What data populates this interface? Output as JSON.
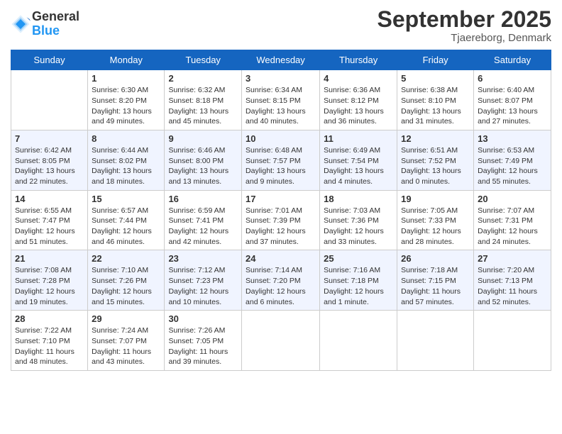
{
  "logo": {
    "general": "General",
    "blue": "Blue"
  },
  "header": {
    "title": "September 2025",
    "subtitle": "Tjaereborg, Denmark"
  },
  "weekdays": [
    "Sunday",
    "Monday",
    "Tuesday",
    "Wednesday",
    "Thursday",
    "Friday",
    "Saturday"
  ],
  "weeks": [
    [
      {
        "day": "",
        "info": ""
      },
      {
        "day": "1",
        "info": "Sunrise: 6:30 AM\nSunset: 8:20 PM\nDaylight: 13 hours\nand 49 minutes."
      },
      {
        "day": "2",
        "info": "Sunrise: 6:32 AM\nSunset: 8:18 PM\nDaylight: 13 hours\nand 45 minutes."
      },
      {
        "day": "3",
        "info": "Sunrise: 6:34 AM\nSunset: 8:15 PM\nDaylight: 13 hours\nand 40 minutes."
      },
      {
        "day": "4",
        "info": "Sunrise: 6:36 AM\nSunset: 8:12 PM\nDaylight: 13 hours\nand 36 minutes."
      },
      {
        "day": "5",
        "info": "Sunrise: 6:38 AM\nSunset: 8:10 PM\nDaylight: 13 hours\nand 31 minutes."
      },
      {
        "day": "6",
        "info": "Sunrise: 6:40 AM\nSunset: 8:07 PM\nDaylight: 13 hours\nand 27 minutes."
      }
    ],
    [
      {
        "day": "7",
        "info": "Sunrise: 6:42 AM\nSunset: 8:05 PM\nDaylight: 13 hours\nand 22 minutes."
      },
      {
        "day": "8",
        "info": "Sunrise: 6:44 AM\nSunset: 8:02 PM\nDaylight: 13 hours\nand 18 minutes."
      },
      {
        "day": "9",
        "info": "Sunrise: 6:46 AM\nSunset: 8:00 PM\nDaylight: 13 hours\nand 13 minutes."
      },
      {
        "day": "10",
        "info": "Sunrise: 6:48 AM\nSunset: 7:57 PM\nDaylight: 13 hours\nand 9 minutes."
      },
      {
        "day": "11",
        "info": "Sunrise: 6:49 AM\nSunset: 7:54 PM\nDaylight: 13 hours\nand 4 minutes."
      },
      {
        "day": "12",
        "info": "Sunrise: 6:51 AM\nSunset: 7:52 PM\nDaylight: 13 hours\nand 0 minutes."
      },
      {
        "day": "13",
        "info": "Sunrise: 6:53 AM\nSunset: 7:49 PM\nDaylight: 12 hours\nand 55 minutes."
      }
    ],
    [
      {
        "day": "14",
        "info": "Sunrise: 6:55 AM\nSunset: 7:47 PM\nDaylight: 12 hours\nand 51 minutes."
      },
      {
        "day": "15",
        "info": "Sunrise: 6:57 AM\nSunset: 7:44 PM\nDaylight: 12 hours\nand 46 minutes."
      },
      {
        "day": "16",
        "info": "Sunrise: 6:59 AM\nSunset: 7:41 PM\nDaylight: 12 hours\nand 42 minutes."
      },
      {
        "day": "17",
        "info": "Sunrise: 7:01 AM\nSunset: 7:39 PM\nDaylight: 12 hours\nand 37 minutes."
      },
      {
        "day": "18",
        "info": "Sunrise: 7:03 AM\nSunset: 7:36 PM\nDaylight: 12 hours\nand 33 minutes."
      },
      {
        "day": "19",
        "info": "Sunrise: 7:05 AM\nSunset: 7:33 PM\nDaylight: 12 hours\nand 28 minutes."
      },
      {
        "day": "20",
        "info": "Sunrise: 7:07 AM\nSunset: 7:31 PM\nDaylight: 12 hours\nand 24 minutes."
      }
    ],
    [
      {
        "day": "21",
        "info": "Sunrise: 7:08 AM\nSunset: 7:28 PM\nDaylight: 12 hours\nand 19 minutes."
      },
      {
        "day": "22",
        "info": "Sunrise: 7:10 AM\nSunset: 7:26 PM\nDaylight: 12 hours\nand 15 minutes."
      },
      {
        "day": "23",
        "info": "Sunrise: 7:12 AM\nSunset: 7:23 PM\nDaylight: 12 hours\nand 10 minutes."
      },
      {
        "day": "24",
        "info": "Sunrise: 7:14 AM\nSunset: 7:20 PM\nDaylight: 12 hours\nand 6 minutes."
      },
      {
        "day": "25",
        "info": "Sunrise: 7:16 AM\nSunset: 7:18 PM\nDaylight: 12 hours\nand 1 minute."
      },
      {
        "day": "26",
        "info": "Sunrise: 7:18 AM\nSunset: 7:15 PM\nDaylight: 11 hours\nand 57 minutes."
      },
      {
        "day": "27",
        "info": "Sunrise: 7:20 AM\nSunset: 7:13 PM\nDaylight: 11 hours\nand 52 minutes."
      }
    ],
    [
      {
        "day": "28",
        "info": "Sunrise: 7:22 AM\nSunset: 7:10 PM\nDaylight: 11 hours\nand 48 minutes."
      },
      {
        "day": "29",
        "info": "Sunrise: 7:24 AM\nSunset: 7:07 PM\nDaylight: 11 hours\nand 43 minutes."
      },
      {
        "day": "30",
        "info": "Sunrise: 7:26 AM\nSunset: 7:05 PM\nDaylight: 11 hours\nand 39 minutes."
      },
      {
        "day": "",
        "info": ""
      },
      {
        "day": "",
        "info": ""
      },
      {
        "day": "",
        "info": ""
      },
      {
        "day": "",
        "info": ""
      }
    ]
  ]
}
